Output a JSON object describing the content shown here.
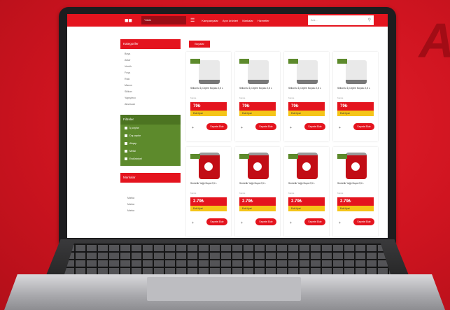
{
  "background_letter": "A",
  "colors": {
    "brand_red": "#e4141e",
    "filter_green": "#5d8a2c",
    "price_yellow": "#f5c518"
  },
  "topbar": {
    "logo_icon": "store-logo-icon",
    "search_placeholder": "Yükle",
    "nav": [
      "Kampanyalar",
      "Ayın ürünleri",
      "Markalar",
      "Hizmetler"
    ],
    "search_field": "Ara..."
  },
  "sidebar": {
    "categories_title": "Kategoriler",
    "categories": [
      "Boya",
      "Astar",
      "Vernik",
      "Fırça",
      "Rulo",
      "Macun",
      "Silikon",
      "Yapıştırıcı",
      "Aksesuar"
    ],
    "filters_title": "Filtreler",
    "filters": [
      "İç cephe",
      "Dış cephe",
      "Ahşap",
      "Metal",
      "Endüstriyel"
    ],
    "brands_title": "Markalar",
    "brands": [
      "Marka",
      "Marka",
      "Marka"
    ]
  },
  "tab_chip": "Boyalar",
  "products": [
    {
      "title": "Silikonlu İç Cephe Boyası 2,5 L",
      "brand": "Marka",
      "price": "79₺",
      "old": "Eski fiyat",
      "button": "Sepete Ekle",
      "type": "white"
    },
    {
      "title": "Silikonlu İç Cephe Boyası 2,5 L",
      "brand": "Marka",
      "price": "79₺",
      "old": "Eski fiyat",
      "button": "Sepete Ekle",
      "type": "white"
    },
    {
      "title": "Silikonlu İç Cephe Boyası 2,5 L",
      "brand": "Marka",
      "price": "79₺",
      "old": "Eski fiyat",
      "button": "Sepete Ekle",
      "type": "white"
    },
    {
      "title": "Silikonlu İç Cephe Boyası 2,5 L",
      "brand": "Marka",
      "price": "79₺",
      "old": "Eski fiyat",
      "button": "Sepete Ekle",
      "type": "white"
    },
    {
      "title": "Sentetik Yağlı Boya 2,5 L",
      "brand": "Marka",
      "price": "2.79₺",
      "old": "Eski fiyat",
      "button": "Sepete Ekle",
      "type": "red"
    },
    {
      "title": "Sentetik Yağlı Boya 2,5 L",
      "brand": "Marka",
      "price": "2.79₺",
      "old": "Eski fiyat",
      "button": "Sepete Ekle",
      "type": "red"
    },
    {
      "title": "Sentetik Yağlı Boya 2,5 L",
      "brand": "Marka",
      "price": "2.79₺",
      "old": "Eski fiyat",
      "button": "Sepete Ekle",
      "type": "red"
    },
    {
      "title": "Sentetik Yağlı Boya 2,5 L",
      "brand": "Marka",
      "price": "2.79₺",
      "old": "Eski fiyat",
      "button": "Sepete Ekle",
      "type": "red"
    }
  ]
}
